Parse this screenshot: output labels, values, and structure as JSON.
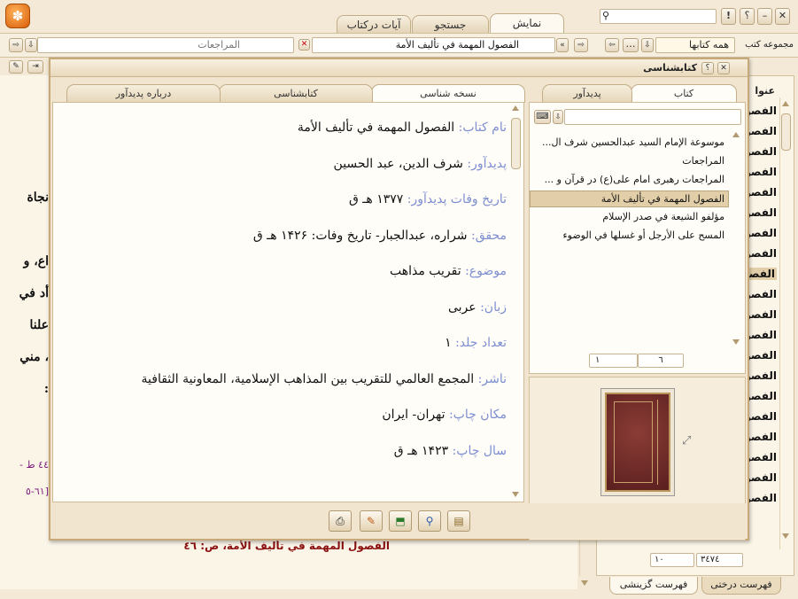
{
  "main_tabs": {
    "display": "نمایش",
    "search": "جستجو",
    "quran_verses": "آیات درکتاب"
  },
  "toolbar": {
    "window_buttons": {
      "close": "✕",
      "minimize": "–",
      "help": "؟",
      "info": "!"
    },
    "book_collection_label": "مجموعه کتب",
    "book_collection_value": "همه کتابها",
    "current_book_tab": "الفصول المهمة في تأليف الأمة",
    "other_book_tab": "المراجعات"
  },
  "left_sidebar": {
    "header": "عنوا",
    "items": [
      "الفصو",
      "الفصو",
      "الفصو",
      "الفصو",
      "الفصو",
      "الفصو",
      "الفصو",
      "الفصو",
      "الفصو",
      "الفصو",
      "الفصو",
      "الفصو",
      "الفصو",
      "الفصو",
      "الفصو",
      "الفصو",
      "الفصو",
      "الفصو",
      "الفصو",
      "الفصو"
    ],
    "selected_index": 8,
    "page_fields": {
      "left": "١٠",
      "right": "٣٤٧٤"
    },
    "bottom_tabs": {
      "tree": "فهرست درختی",
      "selective": "فهرست گزینشی"
    }
  },
  "reader_background": {
    "fragments": [
      "نجاة",
      "اع، و",
      "أد في",
      "علنا",
      "، مني",
      ":"
    ],
    "ref1": "٤٤ ط -",
    "ref2": "[٦١-٥",
    "footer": "الفصول المهمة في تأليف الأمة، ص: ٤٦"
  },
  "dialog": {
    "title": "کتابشناسی",
    "left_tabs": {
      "book": "کتاب",
      "author": "پدیدآور"
    },
    "right_tabs": {
      "copy_id": "نسخه شناسی",
      "bibliography": "کتابشناسی",
      "about_author": "درباره پدیدآور"
    },
    "book_list": [
      "موسوعة الإمام السيد عبدالحسين شرف ال...",
      "المراجعات",
      "المراجعات رهبری امام علی(ع) در قرآن و ...",
      "الفصول المهمة في تأليف الأمة",
      "مؤلفو الشيعة في صدر الإسلام",
      "المسح على الأرجل أو غسلها في الوضوء"
    ],
    "selected_book_index": 3,
    "list_page": {
      "left": "١",
      "right": "٦"
    },
    "info": [
      {
        "label": "نام کتاب:",
        "value": "الفصول المهمة في تأليف الأمة"
      },
      {
        "label": "پدیدآور:",
        "value": "شرف الدين، عبد الحسين"
      },
      {
        "label": "تاریخ وفات پدیدآور:",
        "value": "۱۳۷۷ هـ ق"
      },
      {
        "label": "محقق:",
        "value": "شراره، عبدالجبار- تاریخ وفات: ۱۴۲۶ هـ ق"
      },
      {
        "label": "موضوع:",
        "value": "تقريب مذاهب"
      },
      {
        "label": "زبان:",
        "value": "عربی"
      },
      {
        "label": "تعداد جلد:",
        "value": "۱"
      },
      {
        "label": "ناشر:",
        "value": "المجمع العالمي للتقريب بين المذاهب الإسلامية، المعاونية الثقافية"
      },
      {
        "label": "مکان چاپ:",
        "value": "تهران- ایران"
      },
      {
        "label": "سال چاپ:",
        "value": "۱۴۲۳ هـ ق"
      }
    ]
  },
  "colors": {
    "accent_label": "#7e8fd1",
    "selected_row": "#e2cfa9",
    "book_cover": "#6e2a2a",
    "dialog_border": "#c7a878"
  }
}
